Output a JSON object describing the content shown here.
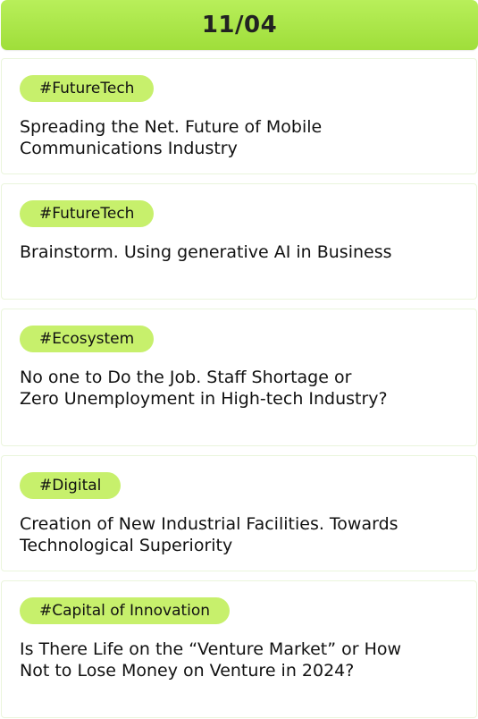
{
  "header": {
    "date": "11/04"
  },
  "sessions": [
    {
      "tag": "#FutureTech",
      "title": "Spreading the Net. Future of Mobile Communications Industry"
    },
    {
      "tag": "#FutureTech",
      "title": "Brainstorm. Using generative AI in Business"
    },
    {
      "tag": "#Ecosystem",
      "title": "No one to Do the Job. Staff Shortage or Zero Unemployment in High-tech Industry?"
    },
    {
      "tag": "#Digital",
      "title": "Creation of New Industrial Facilities. Towards Technological Superiority"
    },
    {
      "tag": "#Capital of Innovation",
      "title": "Is There Life on the “Venture Market” or How Not to Lose Money on Venture in 2024?"
    }
  ],
  "colors": {
    "header_green": "#a6e444",
    "tag_green": "#c7f06c",
    "card_border": "#eaf5dc"
  }
}
